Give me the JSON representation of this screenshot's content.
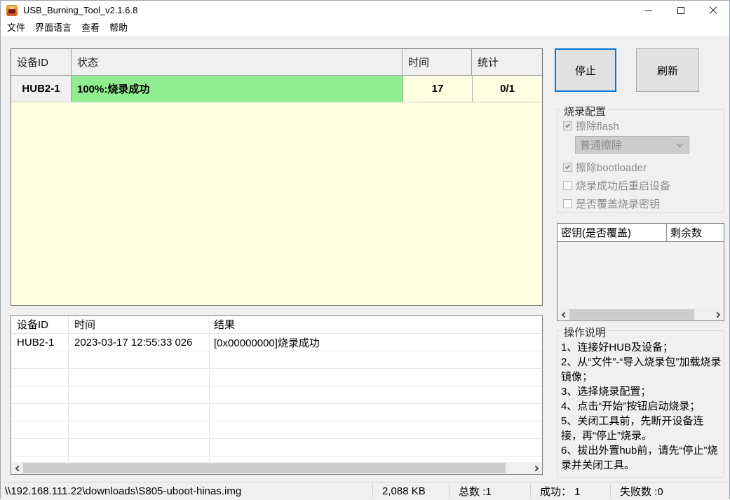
{
  "window": {
    "title": "USB_Burning_Tool_v2.1.6.8"
  },
  "menu": {
    "items": [
      "文件",
      "界面语言",
      "查看",
      "帮助"
    ]
  },
  "device_table": {
    "headers": [
      "设备ID",
      "状态",
      "时间",
      "统计"
    ],
    "row": {
      "device_id": "HUB2-1",
      "status": "100%:烧录成功",
      "time": "17",
      "stats": "0/1"
    }
  },
  "actions": {
    "stop_label": "停止",
    "refresh_label": "刷新"
  },
  "burn_config": {
    "title": "烧录配置",
    "erase_flash_label": "擦除flash",
    "erase_flash_checked": true,
    "erase_mode_value": "普通擦除",
    "erase_bootloader_label": "擦除bootloader",
    "erase_bootloader_checked": true,
    "reboot_label": "烧录成功后重启设备",
    "reboot_checked": false,
    "overwrite_key_label": "是否覆盖烧录密钥",
    "overwrite_key_checked": false
  },
  "key_table": {
    "headers": [
      "密钥(是否覆盖)",
      "剩余数"
    ],
    "rows": []
  },
  "instructions": {
    "title": "操作说明",
    "lines": [
      "1、连接好HUB及设备；",
      "2、从“文件”-“导入烧录包”加载烧录镜像；",
      "3、选择烧录配置；",
      "4、点击“开始”按钮启动烧录；",
      "5、关闭工具前，先断开设备连接，再“停止”烧录。",
      "6、拔出外置hub前，请先“停止”烧录并关闭工具。"
    ]
  },
  "log_table": {
    "headers": [
      "设备ID",
      "时间",
      "结果"
    ],
    "rows": [
      [
        "HUB2-1",
        "2023-03-17 12:55:33 026",
        "[0x00000000]烧录成功"
      ]
    ]
  },
  "status_bar": {
    "image_path": "\\\\192.168.111.22\\downloads\\S805-uboot-hinas.img",
    "image_size": "2,088 KB",
    "total": "总数 :1",
    "success": "成功： 1",
    "failed": "失败数 :0"
  },
  "colors": {
    "accent_blue": "#0078d7",
    "success_green": "#90ee90",
    "table_yellow": "#ffffe1",
    "window_bg": "#f0f0f0",
    "button_bg": "#e1e1e1"
  }
}
